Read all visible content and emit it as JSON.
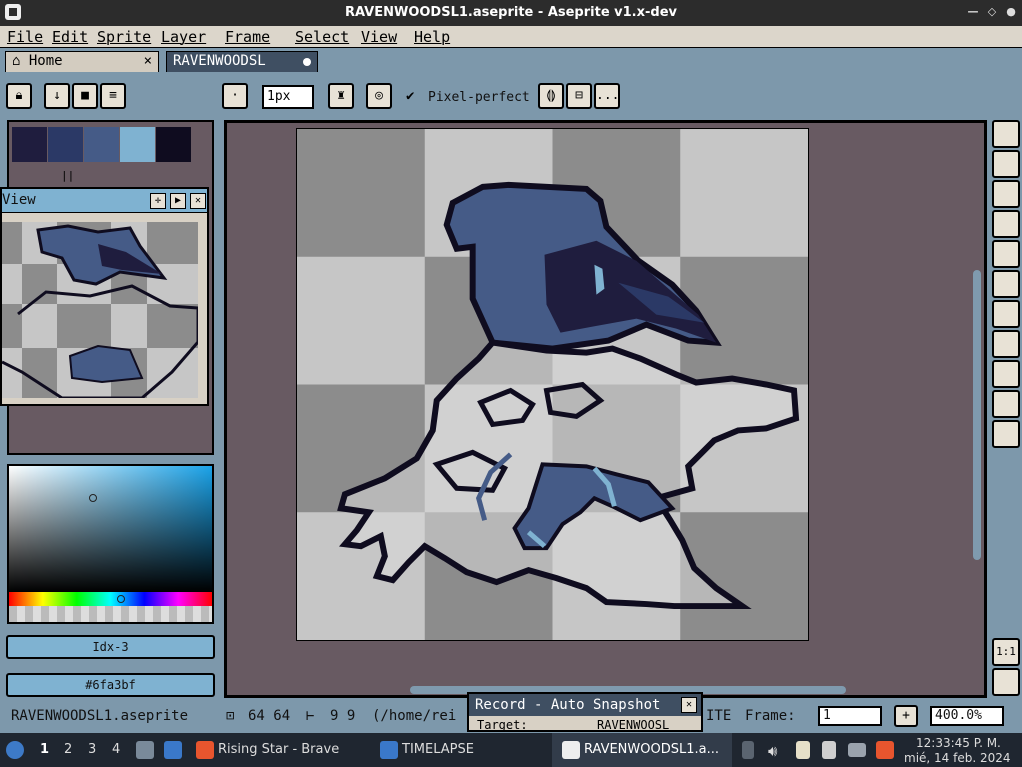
{
  "window": {
    "title": "RAVENWOODSL1.aseprite - Aseprite v1.x-dev"
  },
  "menu": [
    "File",
    "Edit",
    "Sprite",
    "Layer",
    "Frame",
    "Select",
    "View",
    "Help"
  ],
  "tabs": {
    "home": "Home",
    "file": "RAVENWOODSL",
    "home_close": "×"
  },
  "toolbar": {
    "brush_size": "1px",
    "pixel_perfect_label": "Pixel-perfect",
    "more_label": "..."
  },
  "palette": {
    "colors": [
      "#1f1d3e",
      "#2b3966",
      "#455b87",
      "#7fb2d1",
      "#0f0c1f"
    ],
    "label": "||"
  },
  "preview": {
    "title": "View"
  },
  "color_picker": {
    "index_label": "Idx-3",
    "hex_label": "#6fa3bf"
  },
  "status": {
    "filename": "RAVENWOODSL1.aseprite",
    "size": "64 64",
    "pos": "9 9",
    "path": "(/home/rei",
    "tail": "ITE",
    "frame_label": "Frame:",
    "frame_value": "1",
    "zoom": "400.0%"
  },
  "record": {
    "title": "Record - Auto Snapshot",
    "target_label": "Target:",
    "target_value": "RAVENWOOSL"
  },
  "tools": [
    "magic-wand",
    "pencil",
    "eraser",
    "eyedropper",
    "zoom",
    "move",
    "fill",
    "line",
    "rectangle",
    "blur",
    "spray"
  ],
  "zoom_buttons": [
    "1:1"
  ],
  "taskbar": {
    "workspaces": [
      "1",
      "2",
      "3",
      "4"
    ],
    "apps": [
      "Rising Star - Brave",
      "TIMELAPSE",
      "RAVENWOODSL1.a..."
    ],
    "time": "12:33:45 P. M.",
    "date": "mié, 14 feb. 2024"
  },
  "colors": {
    "accent": "#7fb2d1",
    "panel_bg": "#685a62",
    "ui_bg": "#7d98ab",
    "checker_dark": "#8c8c8c",
    "checker_light": "#c6c6c6"
  }
}
